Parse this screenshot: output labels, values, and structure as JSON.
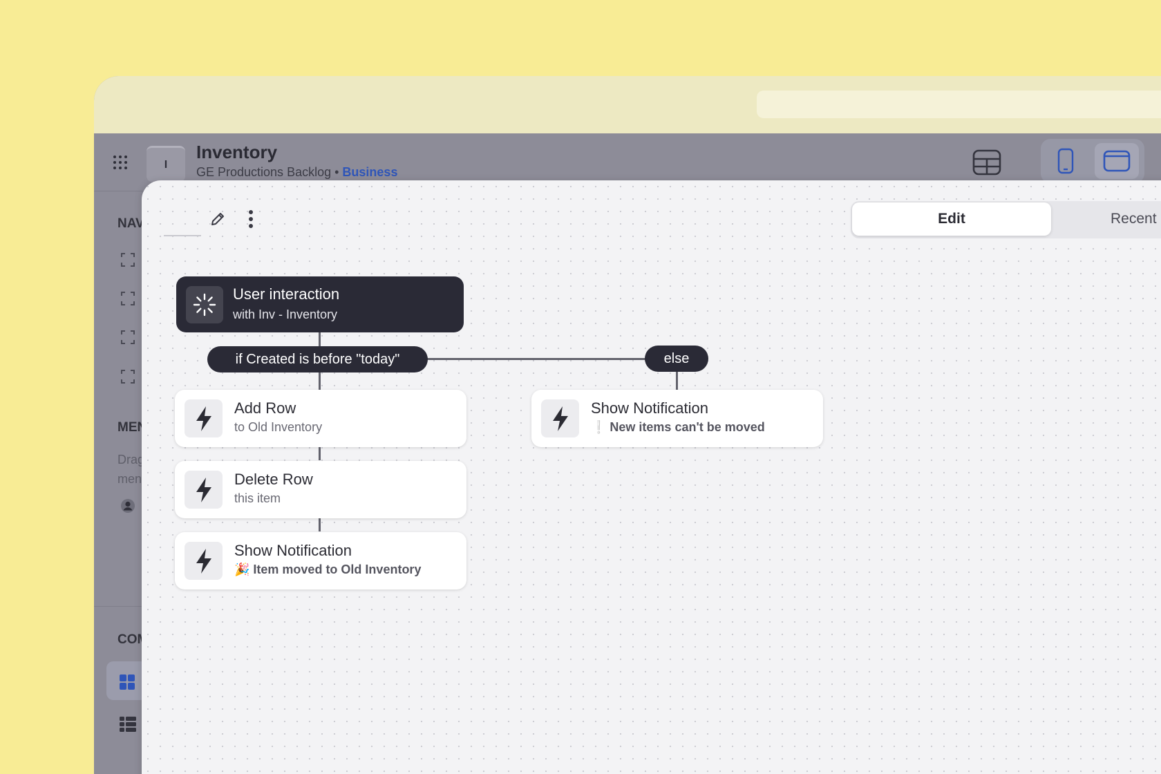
{
  "app": {
    "title": "Inventory",
    "thumb_letter": "I",
    "subtitle_prefix": "GE Productions Backlog •",
    "subtitle_plan": "Business"
  },
  "sidebar": {
    "nav_label": "NAV",
    "menu_label": "MEN",
    "menu_hint_1": "Drag",
    "menu_hint_2": "men",
    "components_label": "COM"
  },
  "tabs": [
    {
      "label": "Edit",
      "selected": true
    },
    {
      "label": "Recent",
      "selected": false
    }
  ],
  "flow": {
    "trigger": {
      "title": "User interaction",
      "subtitle": "with Inv - Inventory",
      "icon": "spinner-icon"
    },
    "condition": {
      "label": "if Created is before \"today\""
    },
    "else_branch": {
      "label": "else"
    },
    "actions": [
      {
        "title": "Add Row",
        "subtitle": "to Old Inventory",
        "icon": "lightning-icon"
      },
      {
        "title": "Delete Row",
        "subtitle": "this item",
        "icon": "lightning-icon"
      },
      {
        "title": "Show Notification",
        "subtitle": "🎉 Item moved to Old Inventory",
        "icon": "lightning-icon"
      }
    ],
    "else_actions": [
      {
        "title": "Show Notification",
        "subtitle": "❕ New items can't be moved",
        "icon": "lightning-icon"
      }
    ]
  },
  "colors": {
    "background": "#f8ec95",
    "node_dark": "#2a2a36",
    "plan_link": "#2f55b8"
  }
}
